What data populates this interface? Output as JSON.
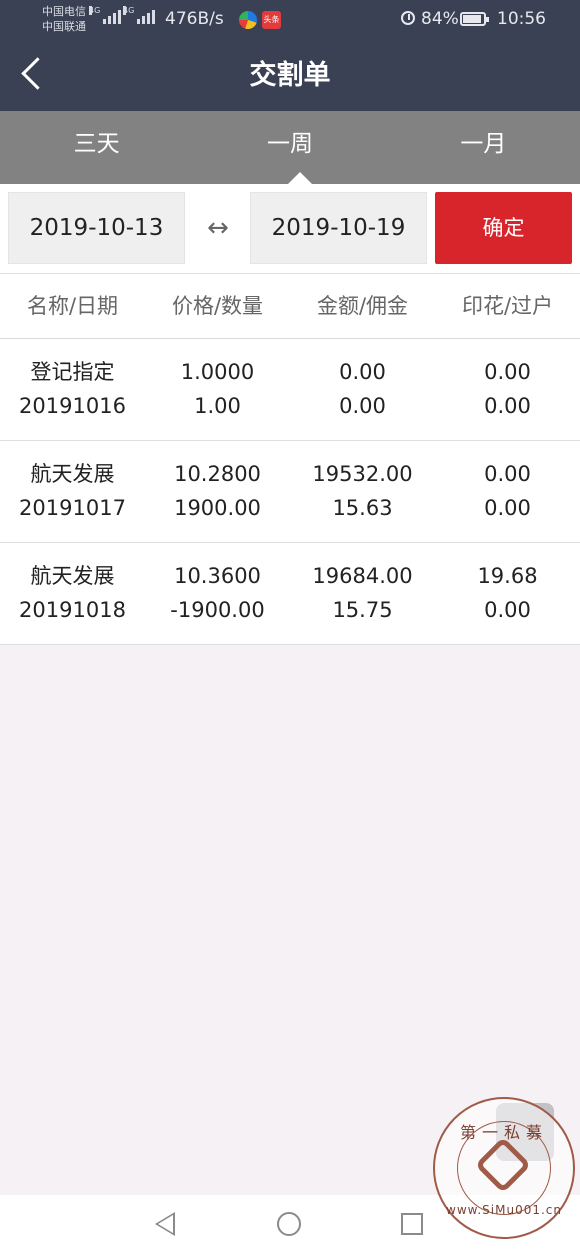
{
  "status_bar": {
    "carrier1": "中国电信",
    "carrier2": "中国联通",
    "net1": "4G",
    "net2": "4G",
    "speed": "476B/s",
    "app_badge": "头条",
    "battery": "84%",
    "time": "10:56"
  },
  "header": {
    "title": "交割单"
  },
  "tabs": [
    {
      "label": "三天",
      "active": false
    },
    {
      "label": "一周",
      "active": true
    },
    {
      "label": "一月",
      "active": false
    }
  ],
  "filter": {
    "start_date": "2019-10-13",
    "swap_symbol": "↔",
    "end_date": "2019-10-19",
    "confirm_label": "确定"
  },
  "table": {
    "headers": [
      "名称/日期",
      "价格/数量",
      "金额/佣金",
      "印花/过户"
    ],
    "rows": [
      {
        "name": "登记指定",
        "date": "20191016",
        "price": "1.0000",
        "qty": "1.00",
        "amount": "0.00",
        "commission": "0.00",
        "stamp": "0.00",
        "transfer": "0.00"
      },
      {
        "name": "航天发展",
        "date": "20191017",
        "price": "10.2800",
        "qty": "1900.00",
        "amount": "19532.00",
        "commission": "15.63",
        "stamp": "0.00",
        "transfer": "0.00"
      },
      {
        "name": "航天发展",
        "date": "20191018",
        "price": "10.3600",
        "qty": "-1900.00",
        "amount": "19684.00",
        "commission": "15.75",
        "stamp": "19.68",
        "transfer": "0.00"
      }
    ]
  },
  "watermark": {
    "top_text": "第一私募",
    "bottom_text": "www.SiMu001.cn"
  },
  "colors": {
    "header_bg": "#3b4155",
    "tab_bg": "#828282",
    "confirm_bg": "#d8252b",
    "page_bg": "#f6f1f4"
  }
}
